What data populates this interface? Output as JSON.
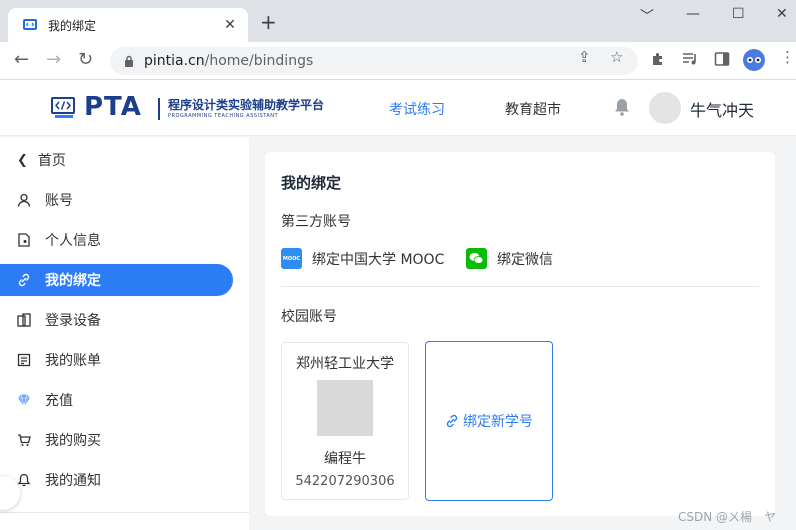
{
  "browser": {
    "tab_title": "我的绑定",
    "tab_close": "✕",
    "new_tab": "+",
    "url_host": "pintia.cn",
    "url_path": "/home/bindings",
    "window_controls": [
      "﹀",
      "—",
      "☐",
      "✕"
    ]
  },
  "header": {
    "logo_text": "PTA",
    "logo_cn": "程序设计类实验辅助教学平台",
    "logo_en": "PROGRAMMING TEACHING ASSISTANT",
    "nav": [
      {
        "label": "考试练习",
        "active": true
      },
      {
        "label": "教育超市",
        "active": false
      }
    ],
    "username": "牛气冲天"
  },
  "sidebar": {
    "back_label": "首页",
    "items": [
      {
        "label": "账号",
        "icon": "user-icon"
      },
      {
        "label": "个人信息",
        "icon": "profile-icon"
      },
      {
        "label": "我的绑定",
        "icon": "link-icon",
        "active": true
      },
      {
        "label": "登录设备",
        "icon": "device-icon"
      },
      {
        "label": "我的账单",
        "icon": "bill-icon"
      },
      {
        "label": "充值",
        "icon": "diamond-icon"
      },
      {
        "label": "我的购买",
        "icon": "cart-icon"
      },
      {
        "label": "我的通知",
        "icon": "bell-icon"
      }
    ]
  },
  "main": {
    "title": "我的绑定",
    "third_party_label": "第三方账号",
    "bindings": [
      {
        "label": "绑定中国大学 MOOC",
        "icon": "mooc-icon",
        "icon_text": "MOOC"
      },
      {
        "label": "绑定微信",
        "icon": "wechat-icon"
      }
    ],
    "campus_label": "校园账号",
    "school": {
      "name": "郑州轻工业大学",
      "user": "编程牛",
      "id": "542207290306"
    },
    "bind_new_label": "绑定新学号"
  },
  "watermark": "CSDN @ㄨ楊　ヤ",
  "colors": {
    "accent": "#2c7cf6",
    "brand": "#1b3f8b",
    "wechat": "#09bb07",
    "mooc": "#2f8cf0"
  }
}
